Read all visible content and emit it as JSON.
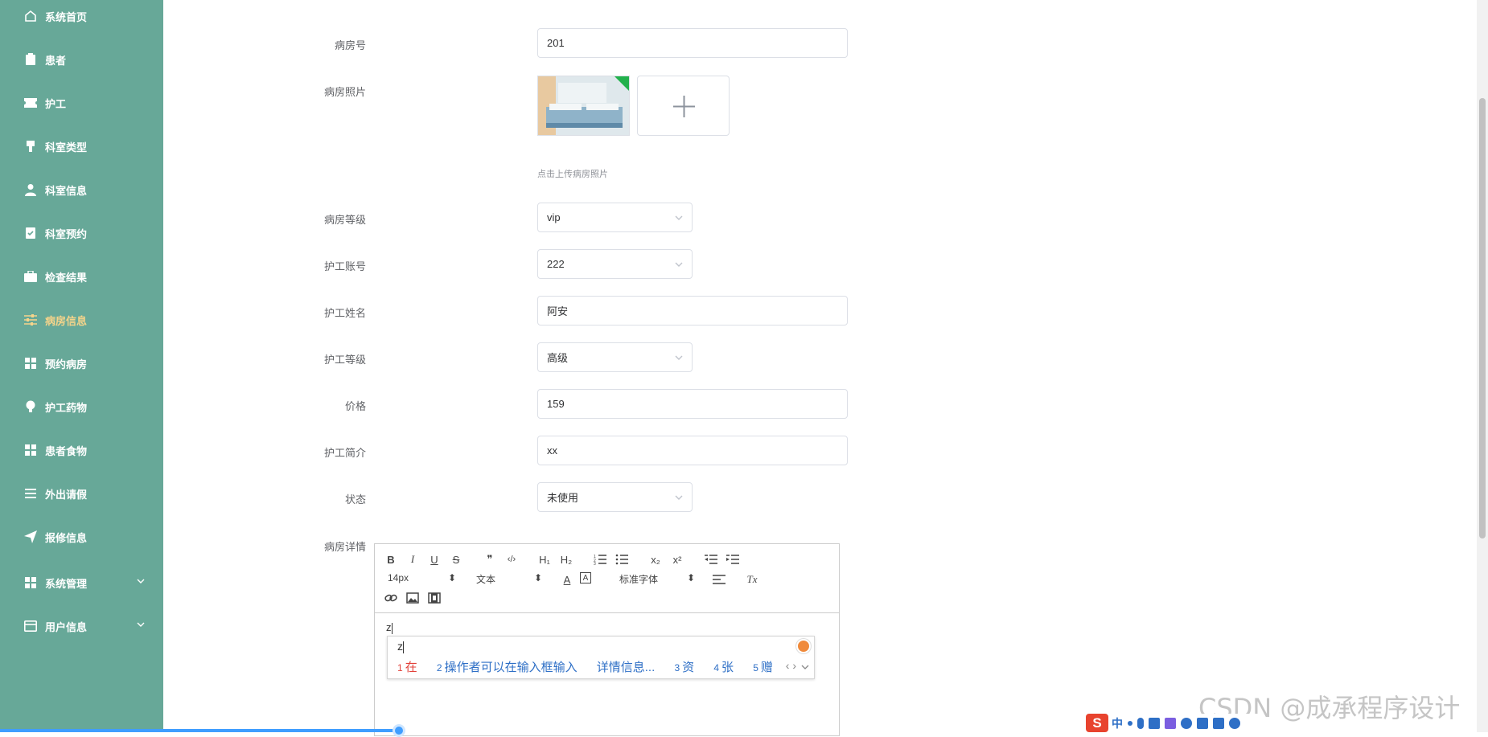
{
  "sidebar": {
    "items": [
      {
        "label": "系统首页",
        "icon": "home-icon"
      },
      {
        "label": "患者",
        "icon": "clipboard-icon"
      },
      {
        "label": "护工",
        "icon": "ticket-icon"
      },
      {
        "label": "科室类型",
        "icon": "pen-icon"
      },
      {
        "label": "科室信息",
        "icon": "user-icon"
      },
      {
        "label": "科室预约",
        "icon": "document-check-icon"
      },
      {
        "label": "检查结果",
        "icon": "briefcase-icon"
      },
      {
        "label": "病房信息",
        "icon": "sliders-icon"
      },
      {
        "label": "预约病房",
        "icon": "grid-icon"
      },
      {
        "label": "护工药物",
        "icon": "lightbulb-icon"
      },
      {
        "label": "患者食物",
        "icon": "grid-icon"
      },
      {
        "label": "外出请假",
        "icon": "list-icon"
      },
      {
        "label": "报修信息",
        "icon": "send-icon"
      },
      {
        "label": "系统管理",
        "icon": "grid-icon"
      },
      {
        "label": "用户信息",
        "icon": "card-icon"
      }
    ],
    "active_index": 7
  },
  "form": {
    "room_no": {
      "label": "病房号",
      "value": "201"
    },
    "room_photo": {
      "label": "病房照片",
      "hint": "点击上传病房照片"
    },
    "room_level": {
      "label": "病房等级",
      "value": "vip"
    },
    "nurse_account": {
      "label": "护工账号",
      "value": "222"
    },
    "nurse_name": {
      "label": "护工姓名",
      "value": "阿安"
    },
    "nurse_level": {
      "label": "护工等级",
      "value": "高级"
    },
    "price": {
      "label": "价格",
      "value": "159"
    },
    "nurse_intro": {
      "label": "护工简介",
      "value": "xx"
    },
    "status": {
      "label": "状态",
      "value": "未使用"
    },
    "room_detail": {
      "label": "病房详情",
      "content": "z"
    }
  },
  "editor_toolbar": {
    "bold": "B",
    "italic": "I",
    "underline": "U",
    "strike": "S",
    "quote": "❞",
    "code": "‹/›",
    "h1": "H₁",
    "h2": "H₂",
    "ol": "☰",
    "ul": "☰",
    "sub": "x₂",
    "sup": "x²",
    "outdent": "⇤",
    "indent": "⇥",
    "font_size": "14px",
    "paragraph": "文本",
    "font_family": "标准字体",
    "color": "A",
    "bg": "A",
    "align": "≡",
    "clear": "Tx"
  },
  "ime": {
    "composition": "z",
    "candidates": [
      {
        "num": "1",
        "text": "在"
      },
      {
        "num": "2",
        "text": "操作者可以在输入框输入"
      },
      {
        "num": "",
        "text": "详情信息..."
      },
      {
        "num": "3",
        "text": "资"
      },
      {
        "num": "4",
        "text": "张"
      },
      {
        "num": "5",
        "text": "赠"
      }
    ],
    "nav": "‹ ›"
  },
  "imebar": {
    "logo": "S",
    "mode": "中"
  },
  "watermark": "CSDN @成承程序设计",
  "colors": {
    "sidebar": "#67a898",
    "active": "#f6d48a",
    "accent": "#409eff"
  }
}
